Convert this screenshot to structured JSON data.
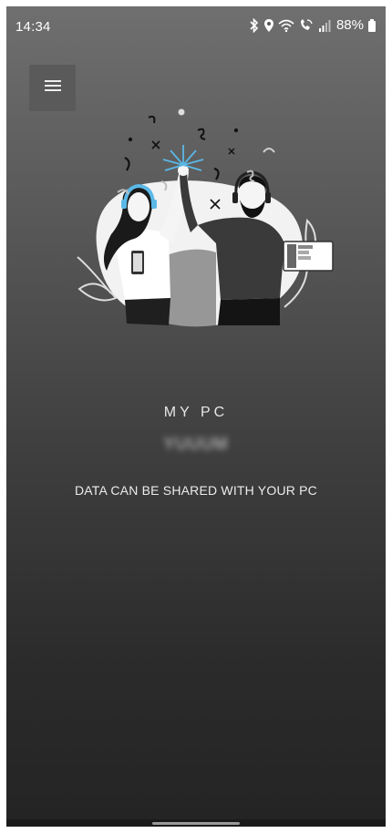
{
  "status_bar": {
    "time": "14:34",
    "battery": "88%",
    "icons": [
      "bluetooth-icon",
      "location-icon",
      "wifi-icon",
      "call-icon",
      "signal-icon",
      "battery-icon"
    ]
  },
  "menu": {
    "icon": "hamburger-menu-icon"
  },
  "illustration": {
    "icon": "high-five-illustration"
  },
  "main": {
    "title": "MY PC",
    "pc_name": "YUUUM",
    "subtitle": "DATA CAN BE SHARED WITH YOUR PC"
  },
  "colors": {
    "background_top": "#6f6f6f",
    "background_bottom": "#242424",
    "accent_blue": "#5bb8e6",
    "text": "#ececec"
  }
}
